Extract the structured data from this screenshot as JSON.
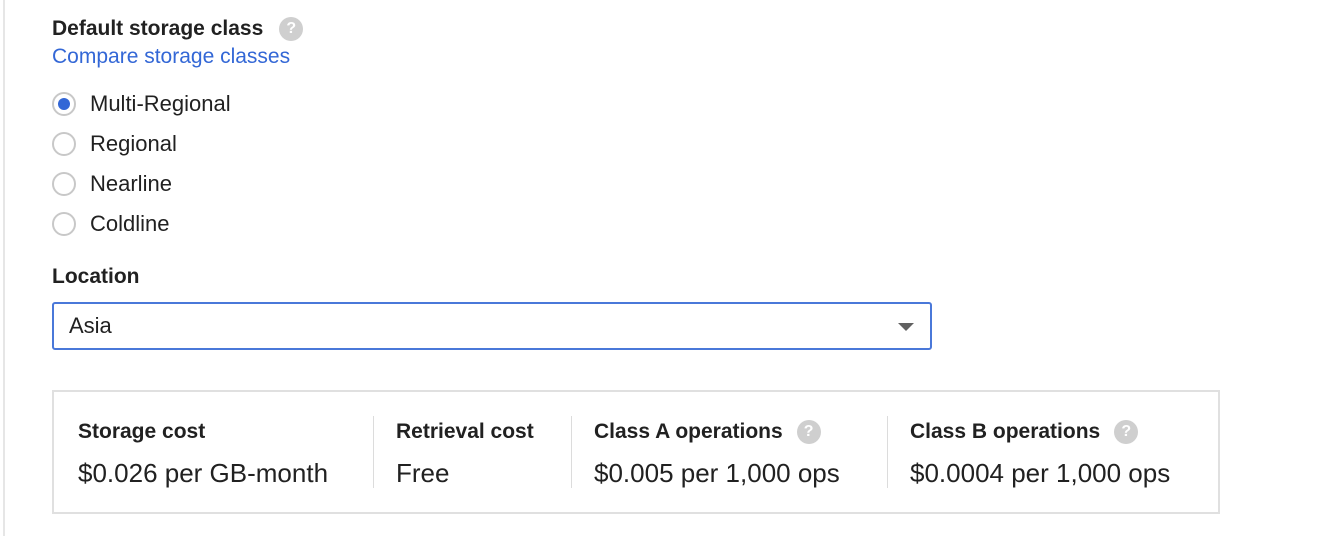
{
  "storage_class": {
    "title": "Default storage class",
    "help_icon": "question-circle-icon",
    "compare_link": "Compare storage classes",
    "options": [
      {
        "label": "Multi-Regional",
        "selected": true
      },
      {
        "label": "Regional",
        "selected": false
      },
      {
        "label": "Nearline",
        "selected": false
      },
      {
        "label": "Coldline",
        "selected": false
      }
    ]
  },
  "location": {
    "label": "Location",
    "selected": "Asia"
  },
  "costs": [
    {
      "title": "Storage cost",
      "value": "$0.026 per GB-month",
      "has_help": false
    },
    {
      "title": "Retrieval cost",
      "value": "Free",
      "has_help": false
    },
    {
      "title": "Class A operations",
      "value": "$0.005 per 1,000 ops",
      "has_help": true
    },
    {
      "title": "Class B operations",
      "value": "$0.0004 per 1,000 ops",
      "has_help": true
    }
  ],
  "colors": {
    "accent": "#3367d6",
    "focus_border": "#4a78d9",
    "help_icon": "#cfcfcf"
  }
}
